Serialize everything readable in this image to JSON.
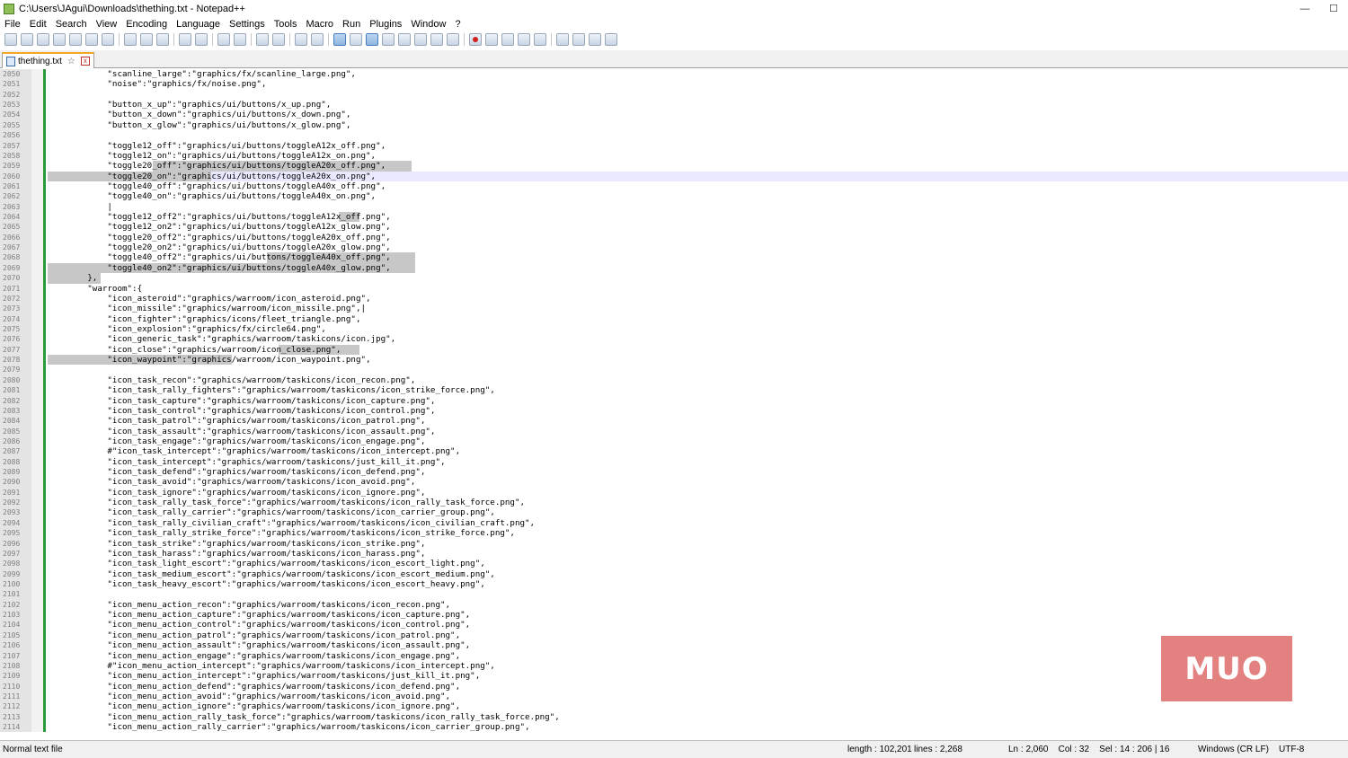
{
  "window": {
    "title": "C:\\Users\\JAgui\\Downloads\\thething.txt - Notepad++",
    "minimize": "—",
    "maximize": "☐"
  },
  "menu": [
    "File",
    "Edit",
    "Search",
    "View",
    "Encoding",
    "Language",
    "Settings",
    "Tools",
    "Macro",
    "Run",
    "Plugins",
    "Window",
    "?"
  ],
  "toolbar": {
    "buttons": [
      "new-file",
      "open-file",
      "save",
      "save-all",
      "close",
      "close-all",
      "print",
      "cut",
      "copy",
      "paste",
      "undo",
      "redo",
      "find",
      "replace",
      "zoom-in",
      "zoom-out",
      "sync-vertical",
      "sync-horizontal",
      "word-wrap",
      "show-all-chars",
      "indent-guide",
      "user-defined-lang",
      "doc-map",
      "function-list",
      "folder-workspace",
      "monitoring",
      "record-macro",
      "stop-recording",
      "playback-macro",
      "run-macro-multiple",
      "save-macro",
      "spell-check",
      "move-up",
      "move-down",
      "compare"
    ]
  },
  "tab": {
    "label": "thething.txt",
    "pin": "☆",
    "close": "x"
  },
  "editor": {
    "lines": [
      {
        "n": "2050",
        "text": "            \"scanline_large\":\"graphics/fx/scanline_large.png\","
      },
      {
        "n": "2051",
        "text": "            \"noise\":\"graphics/fx/noise.png\","
      },
      {
        "n": "2052",
        "text": ""
      },
      {
        "n": "2053",
        "text": "            \"button_x_up\":\"graphics/ui/buttons/x_up.png\","
      },
      {
        "n": "2054",
        "text": "            \"button_x_down\":\"graphics/ui/buttons/x_down.png\","
      },
      {
        "n": "2055",
        "text": "            \"button_x_glow\":\"graphics/ui/buttons/x_glow.png\","
      },
      {
        "n": "2056",
        "text": ""
      },
      {
        "n": "2057",
        "text": "            \"toggle12_off\":\"graphics/ui/buttons/toggleA12x_off.png\","
      },
      {
        "n": "2058",
        "text": "            \"toggle12_on\":\"graphics/ui/buttons/toggleA12x_on.png\","
      },
      {
        "n": "2059",
        "text": "            \"toggle20_off\":\"graphics/ui/buttons/toggleA20x_off.png\","
      },
      {
        "n": "2060",
        "text": "            \"toggle20_on\":\"graphics/ui/buttons/toggleA20x_on.png\","
      },
      {
        "n": "2061",
        "text": "            \"toggle40_off\":\"graphics/ui/buttons/toggleA40x_off.png\","
      },
      {
        "n": "2062",
        "text": "            \"toggle40_on\":\"graphics/ui/buttons/toggleA40x_on.png\","
      },
      {
        "n": "2063",
        "text": "            |"
      },
      {
        "n": "2064",
        "text": "            \"toggle12_off2\":\"graphics/ui/buttons/toggleA12x_off.png\","
      },
      {
        "n": "2065",
        "text": "            \"toggle12_on2\":\"graphics/ui/buttons/toggleA12x_glow.png\","
      },
      {
        "n": "2066",
        "text": "            \"toggle20_off2\":\"graphics/ui/buttons/toggleA20x_off.png\","
      },
      {
        "n": "2067",
        "text": "            \"toggle20_on2\":\"graphics/ui/buttons/toggleA20x_glow.png\","
      },
      {
        "n": "2068",
        "text": "            \"toggle40_off2\":\"graphics/ui/buttons/toggleA40x_off.png\","
      },
      {
        "n": "2069",
        "text": "            \"toggle40_on2\":\"graphics/ui/buttons/toggleA40x_glow.png\","
      },
      {
        "n": "2070",
        "text": "        },"
      },
      {
        "n": "2071",
        "text": "        \"warroom\":{"
      },
      {
        "n": "2072",
        "text": "            \"icon_asteroid\":\"graphics/warroom/icon_asteroid.png\","
      },
      {
        "n": "2073",
        "text": "            \"icon_missile\":\"graphics/warroom/icon_missile.png\",|"
      },
      {
        "n": "2074",
        "text": "            \"icon_fighter\":\"graphics/icons/fleet_triangle.png\","
      },
      {
        "n": "2075",
        "text": "            \"icon_explosion\":\"graphics/fx/circle64.png\","
      },
      {
        "n": "2076",
        "text": "            \"icon_generic_task\":\"graphics/warroom/taskicons/icon.jpg\","
      },
      {
        "n": "2077",
        "text": "            \"icon_close\":\"graphics/warroom/icon_close.png\","
      },
      {
        "n": "2078",
        "text": "            \"icon_waypoint\":\"graphics/warroom/icon_waypoint.png\","
      },
      {
        "n": "2079",
        "text": ""
      },
      {
        "n": "2080",
        "text": "            \"icon_task_recon\":\"graphics/warroom/taskicons/icon_recon.png\","
      },
      {
        "n": "2081",
        "text": "            \"icon_task_rally_fighters\":\"graphics/warroom/taskicons/icon_strike_force.png\","
      },
      {
        "n": "2082",
        "text": "            \"icon_task_capture\":\"graphics/warroom/taskicons/icon_capture.png\","
      },
      {
        "n": "2083",
        "text": "            \"icon_task_control\":\"graphics/warroom/taskicons/icon_control.png\","
      },
      {
        "n": "2084",
        "text": "            \"icon_task_patrol\":\"graphics/warroom/taskicons/icon_patrol.png\","
      },
      {
        "n": "2085",
        "text": "            \"icon_task_assault\":\"graphics/warroom/taskicons/icon_assault.png\","
      },
      {
        "n": "2086",
        "text": "            \"icon_task_engage\":\"graphics/warroom/taskicons/icon_engage.png\","
      },
      {
        "n": "2087",
        "text": "            #\"icon_task_intercept\":\"graphics/warroom/taskicons/icon_intercept.png\","
      },
      {
        "n": "2088",
        "text": "            \"icon_task_intercept\":\"graphics/warroom/taskicons/just_kill_it.png\","
      },
      {
        "n": "2089",
        "text": "            \"icon_task_defend\":\"graphics/warroom/taskicons/icon_defend.png\","
      },
      {
        "n": "2090",
        "text": "            \"icon_task_avoid\":\"graphics/warroom/taskicons/icon_avoid.png\","
      },
      {
        "n": "2091",
        "text": "            \"icon_task_ignore\":\"graphics/warroom/taskicons/icon_ignore.png\","
      },
      {
        "n": "2092",
        "text": "            \"icon_task_rally_task_force\":\"graphics/warroom/taskicons/icon_rally_task_force.png\","
      },
      {
        "n": "2093",
        "text": "            \"icon_task_rally_carrier\":\"graphics/warroom/taskicons/icon_carrier_group.png\","
      },
      {
        "n": "2094",
        "text": "            \"icon_task_rally_civilian_craft\":\"graphics/warroom/taskicons/icon_civilian_craft.png\","
      },
      {
        "n": "2095",
        "text": "            \"icon_task_rally_strike_force\":\"graphics/warroom/taskicons/icon_strike_force.png\","
      },
      {
        "n": "2096",
        "text": "            \"icon_task_strike\":\"graphics/warroom/taskicons/icon_strike.png\","
      },
      {
        "n": "2097",
        "text": "            \"icon_task_harass\":\"graphics/warroom/taskicons/icon_harass.png\","
      },
      {
        "n": "2098",
        "text": "            \"icon_task_light_escort\":\"graphics/warroom/taskicons/icon_escort_light.png\","
      },
      {
        "n": "2099",
        "text": "            \"icon_task_medium_escort\":\"graphics/warroom/taskicons/icon_escort_medium.png\","
      },
      {
        "n": "2100",
        "text": "            \"icon_task_heavy_escort\":\"graphics/warroom/taskicons/icon_escort_heavy.png\","
      },
      {
        "n": "2101",
        "text": ""
      },
      {
        "n": "2102",
        "text": "            \"icon_menu_action_recon\":\"graphics/warroom/taskicons/icon_recon.png\","
      },
      {
        "n": "2103",
        "text": "            \"icon_menu_action_capture\":\"graphics/warroom/taskicons/icon_capture.png\","
      },
      {
        "n": "2104",
        "text": "            \"icon_menu_action_control\":\"graphics/warroom/taskicons/icon_control.png\","
      },
      {
        "n": "2105",
        "text": "            \"icon_menu_action_patrol\":\"graphics/warroom/taskicons/icon_patrol.png\","
      },
      {
        "n": "2106",
        "text": "            \"icon_menu_action_assault\":\"graphics/warroom/taskicons/icon_assault.png\","
      },
      {
        "n": "2107",
        "text": "            \"icon_menu_action_engage\":\"graphics/warroom/taskicons/icon_engage.png\","
      },
      {
        "n": "2108",
        "text": "            #\"icon_menu_action_intercept\":\"graphics/warroom/taskicons/icon_intercept.png\","
      },
      {
        "n": "2109",
        "text": "            \"icon_menu_action_intercept\":\"graphics/warroom/taskicons/just_kill_it.png\","
      },
      {
        "n": "2110",
        "text": "            \"icon_menu_action_defend\":\"graphics/warroom/taskicons/icon_defend.png\","
      },
      {
        "n": "2111",
        "text": "            \"icon_menu_action_avoid\":\"graphics/warroom/taskicons/icon_avoid.png\","
      },
      {
        "n": "2112",
        "text": "            \"icon_menu_action_ignore\":\"graphics/warroom/taskicons/icon_ignore.png\","
      },
      {
        "n": "2113",
        "text": "            \"icon_menu_action_rally_task_force\":\"graphics/warroom/taskicons/icon_rally_task_force.png\","
      },
      {
        "n": "2114",
        "text": "            \"icon_menu_action_rally_carrier\":\"graphics/warroom/taskicons/icon_carrier_group.png\","
      }
    ],
    "selection_color": "#c7c7c7",
    "current_line_color": "#e8e8ff"
  },
  "status": {
    "file_type": "Normal text file",
    "length": "length : 102,201",
    "lines": "lines : 2,268",
    "position": "Ln : 2,060    Col : 32    Sel : 14 : 206 | 16",
    "eol": "Windows (CR LF)",
    "encoding": "UTF-8"
  },
  "watermark": {
    "text": "MUO",
    "color": "#e07070"
  }
}
